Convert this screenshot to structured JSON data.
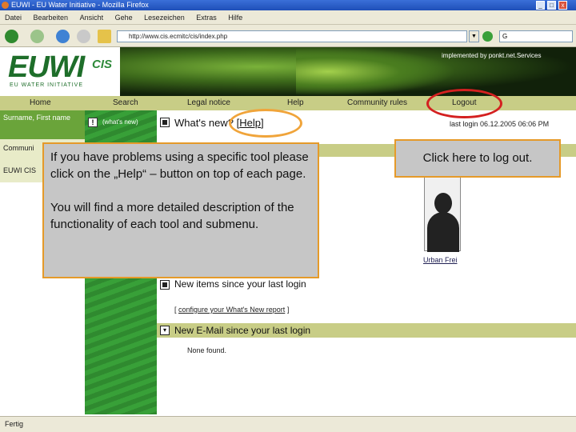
{
  "window": {
    "title": "EUWI - EU Water Initiative - Mozilla Firefox",
    "controls": [
      "_",
      "□",
      "x"
    ]
  },
  "menubar": [
    "Datei",
    "Bearbeiten",
    "Ansicht",
    "Gehe",
    "Lesezeichen",
    "Extras",
    "Hilfe"
  ],
  "toolbar": {
    "address": "http://www.cis.ecmitc/cis/index.php",
    "go": "▼",
    "search_value": "G"
  },
  "banner": {
    "logo": "EUWI",
    "logo_cis": "CIS",
    "logo_subtitle": "EU WATER INITIATIVE",
    "implemented_by": "implemented by ponkt.net.Services"
  },
  "nav": {
    "items": [
      "Home",
      "Search",
      "Legal notice",
      "Help",
      "Community rules",
      "Logout"
    ]
  },
  "sidebar": {
    "user": "Surname, First name",
    "items": [
      "Communi",
      "EUWI CIS"
    ],
    "new_label": "!",
    "whats_new_small": "(what's new)"
  },
  "main": {
    "title_prefix": "What's new?",
    "help_open": "[",
    "help_link": "Help",
    "help_close": "]",
    "last_login": "last login  06.12.2005 06:06 PM",
    "user_name": "Urban Frei",
    "new_items_title": "New items since your last login",
    "configure_open": "[",
    "configure_link": "configure your What's New report",
    "configure_close": "]",
    "email_title": "New E-Mail since your last login",
    "none_found": "None found."
  },
  "status": {
    "text": "Fertig"
  },
  "callouts": {
    "help_p1": "If you have problems using a specific tool please click on the „Help“ – button on top of each page.",
    "help_p2": "You will find a more detailed description of the functionality of each tool and submenu.",
    "logout": "Click here to log out."
  },
  "colors": {
    "callout_border": "#e59a29",
    "help_ring": "#f0a43a",
    "logout_ring": "#d42020",
    "nav_bar": "#c8cd86",
    "sidebar_green": "#2f8a2f"
  }
}
